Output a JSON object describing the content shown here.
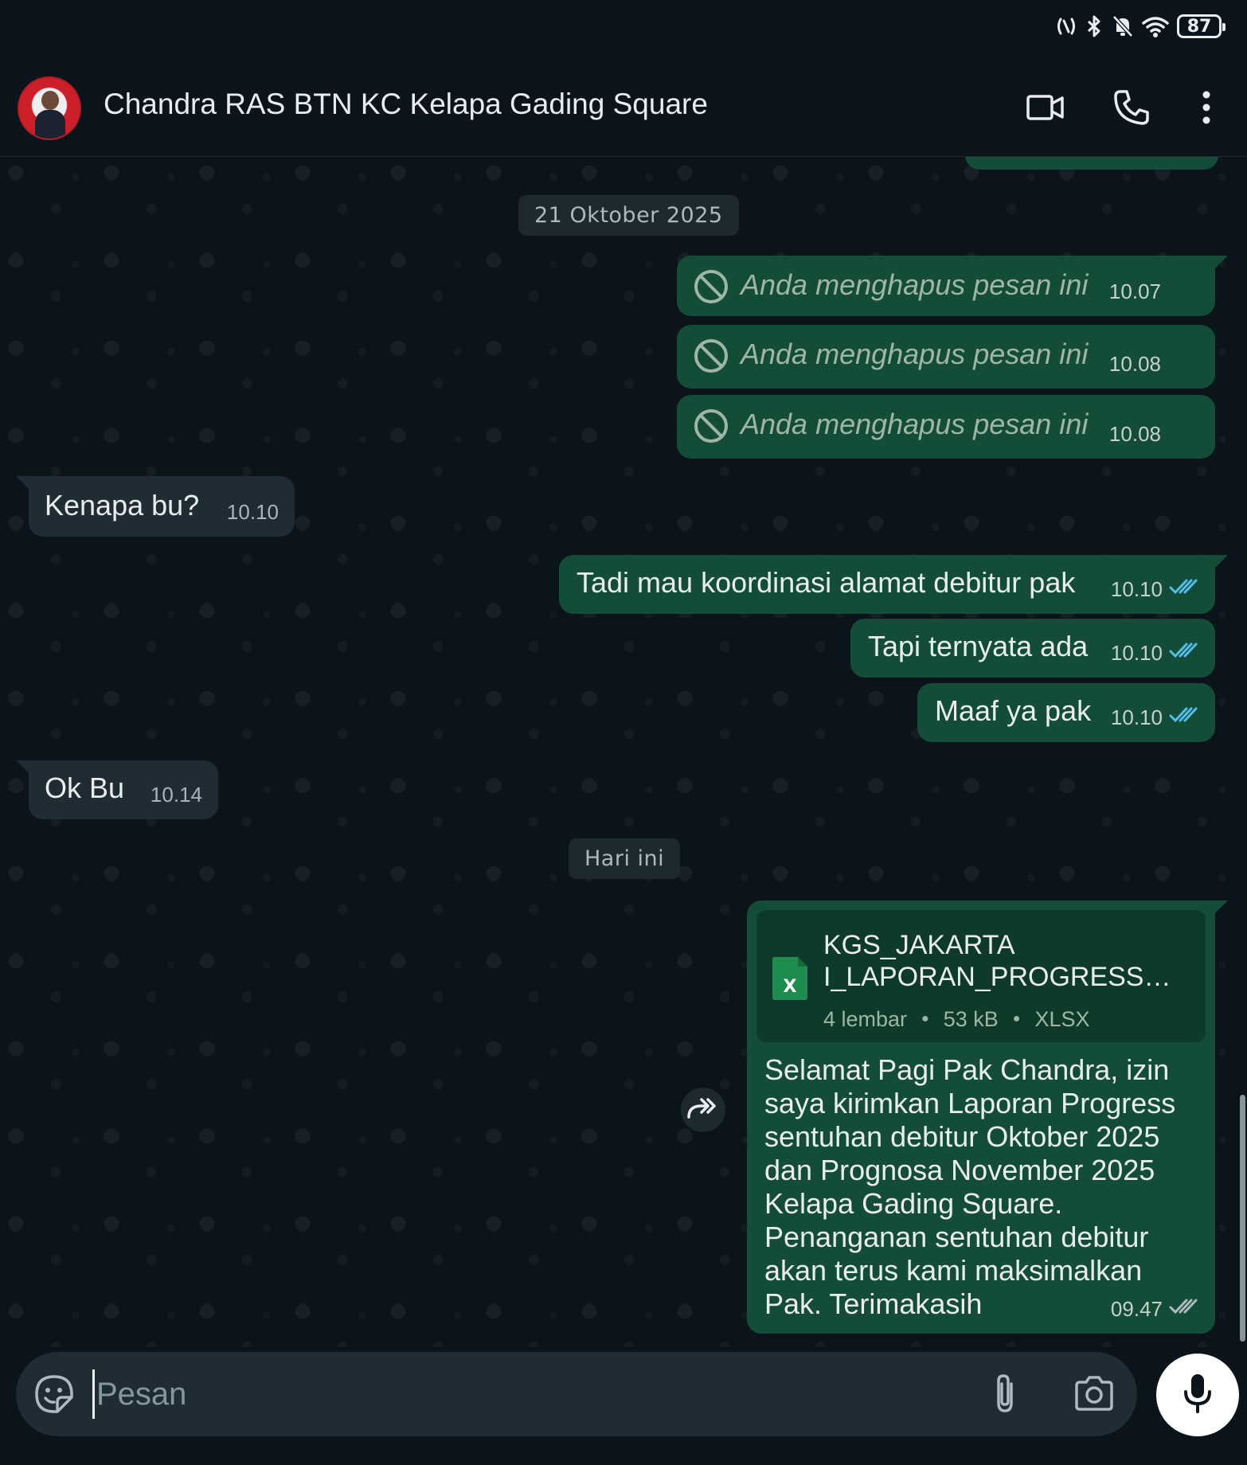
{
  "status_bar": {
    "battery": "87",
    "icons": [
      "nfc-icon",
      "bluetooth-icon",
      "bell-off-icon",
      "wifi-icon",
      "battery-icon"
    ]
  },
  "header": {
    "title": "Chandra RAS BTN KC Kelapa Gading Square",
    "icons": [
      "video-call-icon",
      "voice-call-icon",
      "more-options-icon"
    ]
  },
  "chat": {
    "date_oct": "21 Oktober 2025",
    "date_today": "Hari ini",
    "messages": [
      {
        "dir": "out",
        "text": "Anda menghapus pesan ini",
        "time": "10.07",
        "deleted": true
      },
      {
        "dir": "out",
        "text": "Anda menghapus pesan ini",
        "time": "10.08",
        "deleted": true
      },
      {
        "dir": "out",
        "text": "Anda menghapus pesan ini",
        "time": "10.08",
        "deleted": true
      },
      {
        "dir": "in",
        "text": "Kenapa bu?",
        "time": "10.10"
      },
      {
        "dir": "out",
        "text": "Tadi mau koordinasi alamat debitur pak",
        "time": "10.10",
        "read": true
      },
      {
        "dir": "out",
        "text": "Tapi ternyata ada",
        "time": "10.10",
        "read": true
      },
      {
        "dir": "out",
        "text": "Maaf ya pak",
        "time": "10.10",
        "read": true
      },
      {
        "dir": "in",
        "text": "Ok Bu",
        "time": "10.14"
      },
      {
        "dir": "out",
        "file": {
          "name_line1": "KGS_JAKARTA",
          "name_line2": "I_LAPORAN_PROGRESS B...",
          "pages": "4 lembar",
          "size": "53 kB",
          "ext": "XLSX",
          "icon_letter": "X"
        },
        "caption": "Selamat Pagi Pak Chandra, izin saya kirimkan Laporan Progress sentuhan debitur Oktober 2025 dan Prognosa November 2025 Kelapa Gading Square. Penanganan sentuhan debitur akan terus kami maksimalkan Pak. Terimakasih",
        "time": "09.47",
        "read": false
      }
    ]
  },
  "composer": {
    "placeholder": "Pesan"
  },
  "colors": {
    "bg": "#0b141a",
    "bubble_out": "#144d37",
    "bubble_in": "#202c33",
    "read_tick": "#53bdeb",
    "xlsx_green": "#1e8c4e"
  }
}
